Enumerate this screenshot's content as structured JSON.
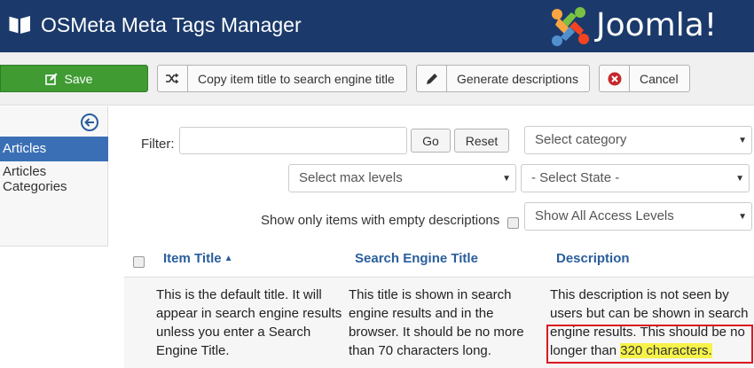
{
  "header": {
    "title": "OSMeta Meta Tags Manager",
    "brand": "Joomla!",
    "brand_color": "#1b3a6b"
  },
  "toolbar": {
    "save_label": "Save",
    "copy_label": "Copy item title to search engine title",
    "generate_label": "Generate descriptions",
    "cancel_label": "Cancel"
  },
  "sidebar": {
    "items": [
      {
        "label": "Articles",
        "active": true
      },
      {
        "label": "Articles Categories",
        "active": false
      }
    ],
    "items_label_1a": "Articles",
    "items_label_1b": "Categories"
  },
  "filter": {
    "label": "Filter:",
    "value": "",
    "go_label": "Go",
    "reset_label": "Reset",
    "category": "Select category",
    "max_levels": "Select max levels",
    "state": "- Select State -",
    "access": "Show All Access Levels",
    "empty_desc_label": "Show only items with empty descriptions"
  },
  "table": {
    "headers": [
      "Item Title",
      "Search Engine Title",
      "Description"
    ],
    "sort_indicator": "▲",
    "rows": [
      {
        "item_title": [
          "This is the default title. It will",
          "appear in search engine results",
          "unless you enter a Search",
          "Engine Title."
        ],
        "search_title": [
          "This title is shown in search",
          "engine results and in the",
          "browser. It should be no more",
          "than 70 characters long."
        ],
        "description": [
          "This description is not seen by",
          "users but can be shown in search",
          "engine results. This should be no",
          "longer than ",
          "320 characters."
        ]
      }
    ]
  },
  "colors": {
    "save_green": "#3f9b32",
    "active_blue": "#3b6fb5",
    "link_blue": "#2a5e9c",
    "highlight_red": "#d9191f",
    "highlight_yellow": "#f6f24a"
  }
}
